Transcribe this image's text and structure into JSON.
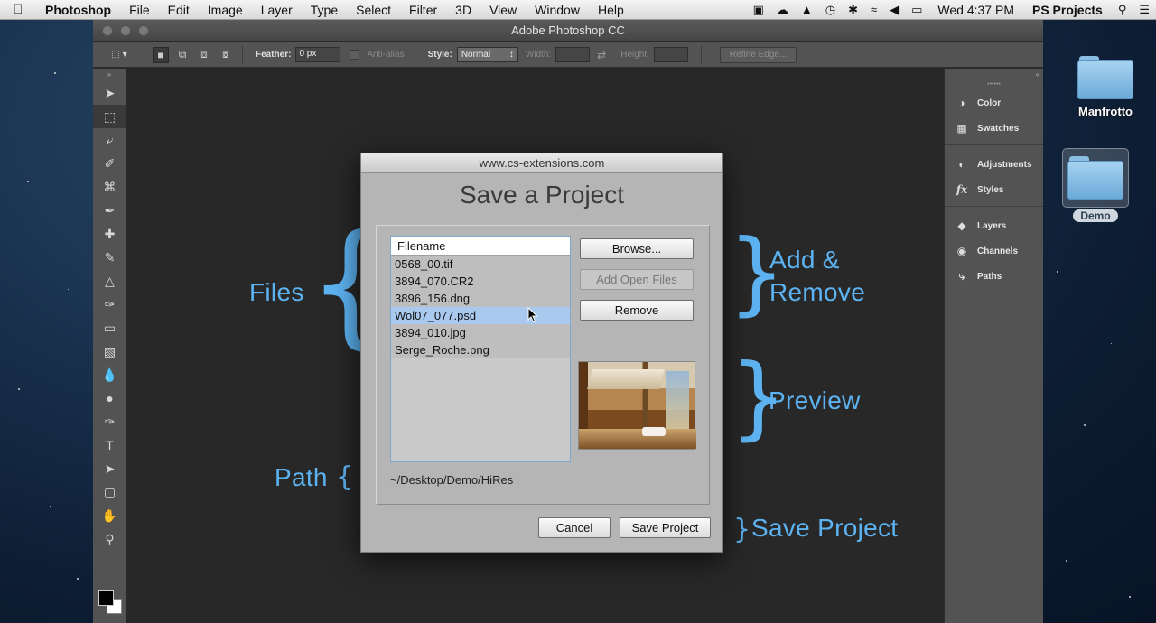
{
  "menubar": {
    "app_name": "Photoshop",
    "items": [
      "File",
      "Edit",
      "Image",
      "Layer",
      "Type",
      "Select",
      "Filter",
      "3D",
      "View",
      "Window",
      "Help"
    ],
    "clock": "Wed 4:37 PM",
    "user": "PS Projects"
  },
  "ps_window": {
    "title": "Adobe Photoshop CC",
    "options": {
      "feather_label": "Feather:",
      "feather_value": "0 px",
      "antialias_label": "Anti-alias",
      "style_label": "Style:",
      "style_value": "Normal",
      "width_label": "Width:",
      "height_label": "Height:",
      "refine_edge_label": "Refine Edge..."
    },
    "panels": [
      {
        "label": "Color",
        "icon": "palette-icon"
      },
      {
        "label": "Swatches",
        "icon": "grid-icon"
      },
      {
        "label": "Adjustments",
        "icon": "adjustments-icon"
      },
      {
        "label": "Styles",
        "icon": "fx-icon"
      },
      {
        "label": "Layers",
        "icon": "layers-icon"
      },
      {
        "label": "Channels",
        "icon": "channels-icon"
      },
      {
        "label": "Paths",
        "icon": "paths-icon"
      }
    ]
  },
  "annotations": {
    "files": "Files",
    "add_remove_1": "Add &",
    "add_remove_2": "Remove",
    "preview": "Preview",
    "path": "Path",
    "save_project": "Save Project"
  },
  "dialog": {
    "title_url": "www.cs-extensions.com",
    "heading": "Save a Project",
    "file_list_header": "Filename",
    "files": [
      "0568_00.tif",
      "3894_070.CR2",
      "3896_156.dng",
      "Wol07_077.psd",
      "3894_010.jpg",
      "Serge_Roche.png"
    ],
    "selected_index": 3,
    "browse_label": "Browse...",
    "add_open_files_label": "Add Open Files",
    "remove_label": "Remove",
    "path": "~/Desktop/Demo/HiRes",
    "cancel_label": "Cancel",
    "save_label": "Save Project"
  },
  "desktop": {
    "icons": [
      {
        "label": "Manfrotto"
      },
      {
        "label": "Demo"
      }
    ]
  },
  "colors": {
    "annotation": "#5db3f2",
    "selection": "#a9c9ef"
  }
}
